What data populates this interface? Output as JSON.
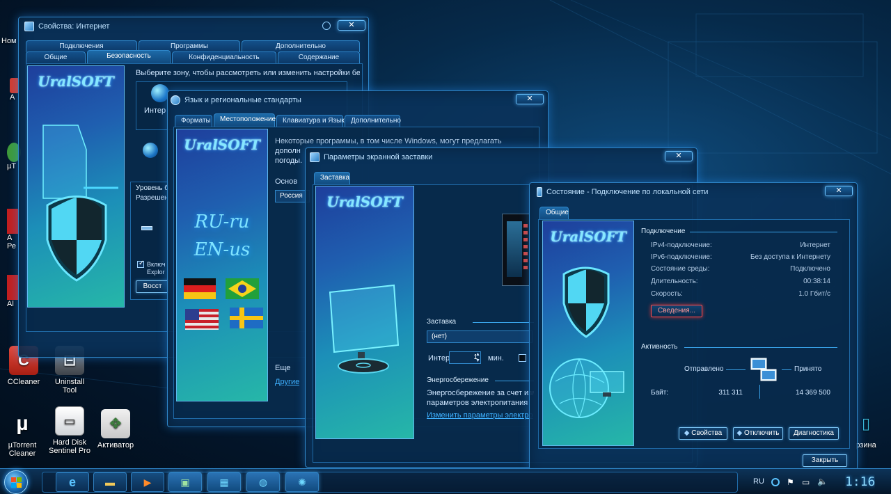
{
  "colors": {
    "accent": "#2f86c9",
    "glow": "#6cc3ff",
    "link": "#3fb1ff",
    "details_button": "#ff4a4a"
  },
  "desktop": {
    "edge_labels": [
      "Ном",
      "A",
      "µT",
      "A",
      "Ре",
      "Al"
    ],
    "icons": [
      {
        "label": "CCleaner",
        "icon": "broom-icon"
      },
      {
        "label": "Uninstall Tool",
        "icon": "uninstall-icon"
      },
      {
        "label": "µTorrent Cleaner",
        "icon": "utorrent-icon"
      },
      {
        "label": "Hard Disk Sentinel Pro",
        "icon": "hard-disk-icon"
      },
      {
        "label": "Активатор",
        "icon": "activator-icon"
      }
    ],
    "recycle_label": "рзина"
  },
  "win_internet": {
    "title": "Свойства: Интернет",
    "tabs_top": [
      "Подключения",
      "Программы",
      "Дополнительно"
    ],
    "tabs_bottom": [
      "Общие",
      "Безопасность",
      "Конфиденциальность",
      "Содержание"
    ],
    "brand": "UralSOFT",
    "zone_prompt": "Выберите зону, чтобы рассмотреть или изменить настройки безопасн",
    "zone_label": "Интер",
    "level_label": "Уровень б",
    "allowed_label": "Разрешен",
    "checkbox_label": "Включ Explor",
    "restore_button": "Восст"
  },
  "win_region": {
    "title": "Язык и региональные стандарты",
    "tabs": [
      "Форматы",
      "Местоположение",
      "Клавиатура и Язык",
      "Дополнительно"
    ],
    "brand": "UralSOFT",
    "lang1": "RU-ru",
    "lang2": "EN-us",
    "intro_text": "Некоторые программы, в том числе Windows, могут предлагать",
    "intro_text2": "дополн",
    "intro_text3": "погоды.",
    "main_label": "Основ",
    "location_value": "Россия",
    "more_label": "Еще",
    "more_link": "Другие"
  },
  "win_screensaver": {
    "title": "Параметры экранной заставки",
    "tab": "Заставка",
    "brand": "UralSOFT",
    "group_screensaver": "Заставка",
    "screensaver_value": "(нет)",
    "interval_label": "Интер",
    "interval_value": "1",
    "minutes_label": "мин.",
    "group_energy": "Энергосбережение",
    "energy_text1": "Энергосбережение за счет изм",
    "energy_text2": "параметров электропитания",
    "energy_link": "Изменить параметры электро"
  },
  "win_status": {
    "title": "Состояние - Подключение по локальной сети",
    "tab": "Общие",
    "brand": "UralSOFT",
    "group_connection": "Подключение",
    "rows": [
      {
        "label": "IPv4-подключение:",
        "value": "Интернет"
      },
      {
        "label": "IPv6-подключение:",
        "value": "Без доступа к Интернету"
      },
      {
        "label": "Состояние среды:",
        "value": "Подключено"
      },
      {
        "label": "Длительность:",
        "value": "00:38:14"
      },
      {
        "label": "Скорость:",
        "value": "1.0 Гбит/с"
      }
    ],
    "details_button": "Сведения...",
    "group_activity": "Активность",
    "sent_label": "Отправлено",
    "received_label": "Принято",
    "bytes_label": "Байт:",
    "bytes_sent": "311 311",
    "bytes_received": "14 369 500",
    "properties_button": "Свойства",
    "disable_button": "Отключить",
    "diagnostics_button": "Диагностика",
    "close_button": "Закрыть"
  },
  "taskbar": {
    "items": [
      {
        "name": "internet-explorer",
        "icon": "ie-icon"
      },
      {
        "name": "explorer",
        "icon": "folder-icon"
      },
      {
        "name": "media-player",
        "icon": "media-player-icon"
      },
      {
        "name": "display-settings",
        "icon": "monitor-icon"
      },
      {
        "name": "control-panel",
        "icon": "control-panel-icon"
      },
      {
        "name": "region-settings",
        "icon": "globe-icon"
      },
      {
        "name": "network-status",
        "icon": "network-icon"
      }
    ],
    "lang": "RU",
    "clock": "1:16"
  }
}
